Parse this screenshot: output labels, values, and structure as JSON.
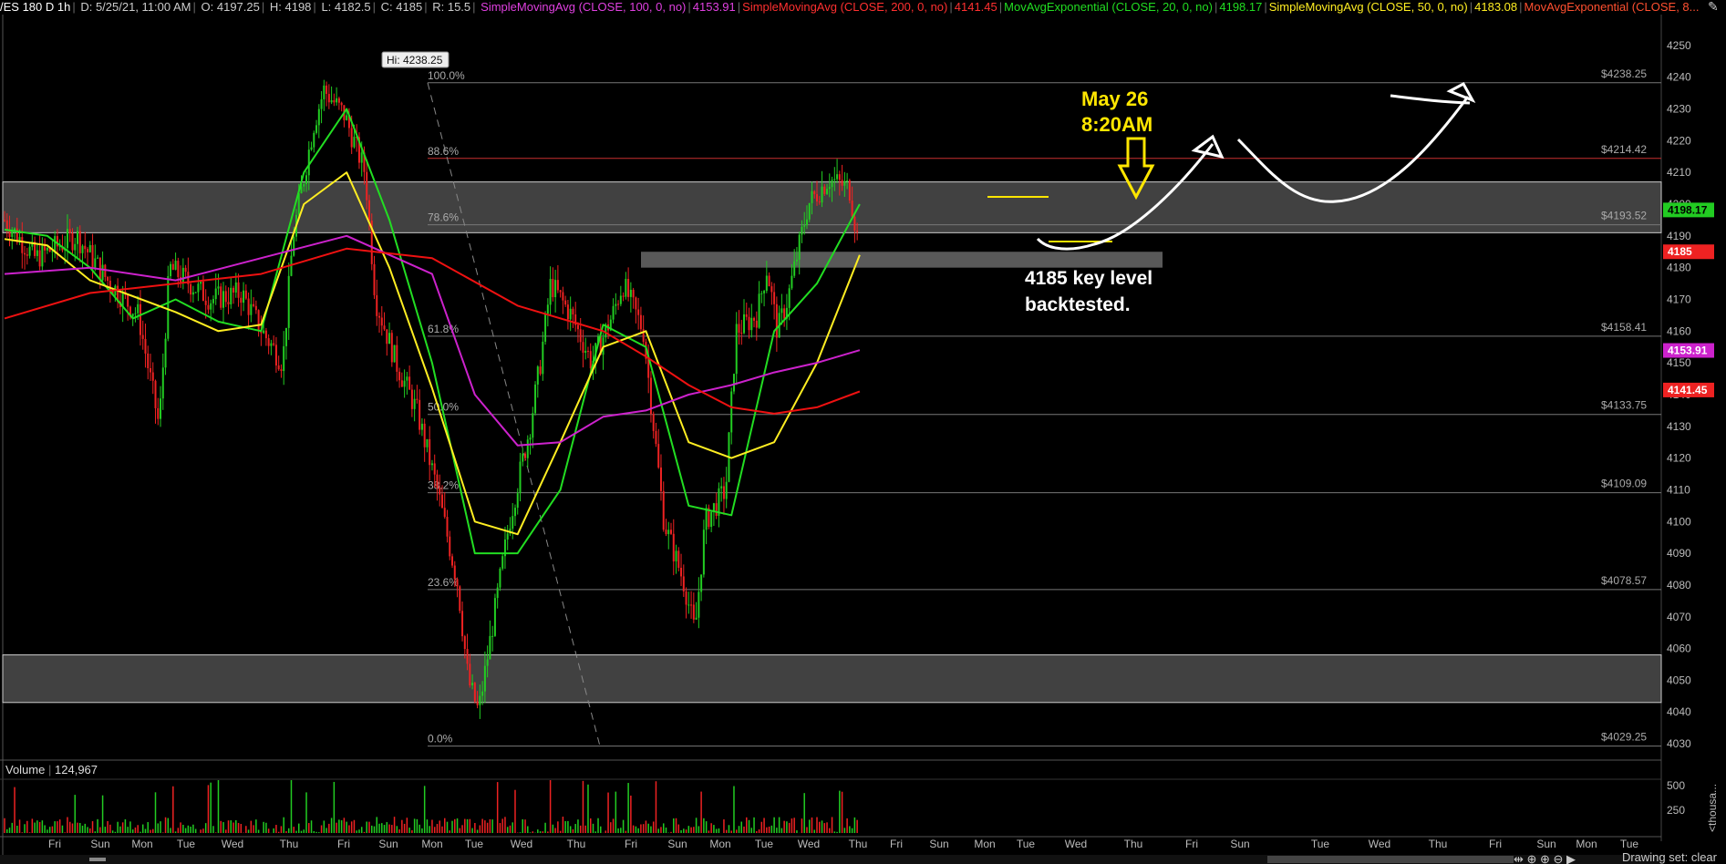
{
  "header": {
    "symbol": "/ES 180 D 1h",
    "date": "D: 5/25/21, 11:00 AM",
    "open": "O: 4197.25",
    "high": "H: 4198",
    "low": "L: 4182.5",
    "close": "C: 4185",
    "range": "R: 15.5",
    "studies": [
      {
        "label": "SimpleMovingAvg (CLOSE, 100, 0, no)",
        "value": "4153.91",
        "color": "#e040e0"
      },
      {
        "label": "SimpleMovingAvg (CLOSE, 200, 0, no)",
        "value": "4141.45",
        "color": "#ff3030"
      },
      {
        "label": "MovAvgExponential (CLOSE, 20, 0, no)",
        "value": "4198.17",
        "color": "#22dd22"
      },
      {
        "label": "SimpleMovingAvg (CLOSE, 50, 0, no)",
        "value": "4183.08",
        "color": "#ffee22"
      },
      {
        "label": "MovAvgExponential (CLOSE, 8...",
        "value": "",
        "color": "#ff5030"
      }
    ]
  },
  "colors": {
    "up": "#22cc22",
    "down": "#ee2222",
    "ema20": "#22dd22",
    "sma50": "#ffee22",
    "sma100": "#cc22cc",
    "sma200": "#ee1111",
    "zone": "#777777",
    "annotation_yellow": "#ffe600"
  },
  "chart_data": {
    "type": "candlestick",
    "ylim": [
      4026,
      4258
    ],
    "y_ticks": [
      4030,
      4040,
      4050,
      4060,
      4070,
      4080,
      4090,
      4100,
      4110,
      4120,
      4130,
      4140,
      4150,
      4160,
      4170,
      4180,
      4190,
      4200,
      4210,
      4220,
      4230,
      4240,
      4250
    ],
    "x_tick_labels": [
      "Fri",
      "Sun",
      "Mon",
      "Tue",
      "Wed",
      "Thu",
      "Fri",
      "Sun",
      "Mon",
      "Tue",
      "Wed",
      "Thu",
      "Fri",
      "Sun",
      "Mon",
      "Tue",
      "Wed",
      "Thu",
      "Fri",
      "Sun",
      "Mon",
      "Tue",
      "Wed",
      "Thu",
      "Fri",
      "Sun",
      "Tue",
      "Wed",
      "Thu",
      "Fri",
      "Sun",
      "Mon",
      "Tue"
    ],
    "high_label": "Hi: 4238.25",
    "fib_levels": [
      {
        "pct": "100.0%",
        "price": 4238.25,
        "label": "$4238.25"
      },
      {
        "pct": "88.6%",
        "price": 4214.42,
        "label": "$4214.42"
      },
      {
        "pct": "78.6%",
        "price": 4193.52,
        "label": "$4193.52"
      },
      {
        "pct": "61.8%",
        "price": 4158.41,
        "label": "$4158.41"
      },
      {
        "pct": "50.0%",
        "price": 4133.75,
        "label": "$4133.75"
      },
      {
        "pct": "38.2%",
        "price": 4109.09,
        "label": "$4109.09"
      },
      {
        "pct": "23.6%",
        "price": 4078.57,
        "label": "$4078.57"
      },
      {
        "pct": "0.0%",
        "price": 4029.25,
        "label": "$4029.25"
      }
    ],
    "zones": [
      {
        "y_low": 4191,
        "y_high": 4207,
        "span": "full"
      },
      {
        "y_low": 4180,
        "y_high": 4185,
        "span": "partial"
      },
      {
        "y_low": 4043,
        "y_high": 4058,
        "span": "full"
      }
    ],
    "price_tags": [
      {
        "value": "4198.17",
        "price": 4198.17,
        "bg": "#22cc22",
        "fg": "#000000"
      },
      {
        "value": "4185",
        "price": 4185,
        "bg": "#ee2222",
        "fg": "#ffffff"
      },
      {
        "value": "4153.91",
        "price": 4153.91,
        "bg": "#cc22cc",
        "fg": "#ffffff"
      },
      {
        "value": "4141.45",
        "price": 4141.45,
        "bg": "#ee2222",
        "fg": "#ffffff"
      }
    ],
    "series": [
      {
        "name": "MovAvgExponential (CLOSE, 20, 0, no)",
        "x": [
          0,
          0.05,
          0.1,
          0.15,
          0.2,
          0.25,
          0.3,
          0.35,
          0.4,
          0.45,
          0.5,
          0.55,
          0.6,
          0.65,
          0.7,
          0.75,
          0.8,
          0.85,
          0.9,
          0.95,
          1
        ],
        "y": [
          4192,
          4190,
          4180,
          4164,
          4170,
          4163,
          4160,
          4210,
          4230,
          4195,
          4150,
          4090,
          4090,
          4110,
          4162,
          4155,
          4105,
          4102,
          4160,
          4175,
          4200
        ]
      },
      {
        "name": "SimpleMovingAvg (CLOSE, 50, 0, no)",
        "x": [
          0,
          0.05,
          0.1,
          0.15,
          0.2,
          0.25,
          0.3,
          0.35,
          0.4,
          0.45,
          0.5,
          0.55,
          0.6,
          0.65,
          0.7,
          0.75,
          0.8,
          0.85,
          0.9,
          0.95,
          1
        ],
        "y": [
          4189,
          4187,
          4176,
          4171,
          4166,
          4160,
          4162,
          4200,
          4210,
          4180,
          4142,
          4100,
          4096,
          4125,
          4155,
          4160,
          4125,
          4120,
          4125,
          4150,
          4184
        ]
      },
      {
        "name": "SimpleMovingAvg (CLOSE, 100, 0, no)",
        "x": [
          0,
          0.1,
          0.2,
          0.3,
          0.4,
          0.5,
          0.55,
          0.6,
          0.65,
          0.7,
          0.75,
          0.8,
          0.85,
          0.9,
          0.95,
          1
        ],
        "y": [
          4178,
          4180,
          4176,
          4183,
          4190,
          4178,
          4140,
          4124,
          4125,
          4133,
          4135,
          4140,
          4143,
          4147,
          4150,
          4154
        ]
      },
      {
        "name": "SimpleMovingAvg (CLOSE, 200, 0, no)",
        "x": [
          0,
          0.1,
          0.2,
          0.3,
          0.4,
          0.5,
          0.6,
          0.7,
          0.75,
          0.8,
          0.85,
          0.9,
          0.95,
          1
        ],
        "y": [
          4164,
          4172,
          4175,
          4178,
          4186,
          4183,
          4168,
          4160,
          4152,
          4143,
          4136,
          4134,
          4136,
          4141
        ]
      }
    ],
    "volume": {
      "label": "Volume",
      "value": "124,967",
      "y_ticks": [
        250,
        500
      ],
      "y_axis_label": "<thousa..."
    }
  },
  "annotations": {
    "date_line1": "May 26",
    "date_line2": "8:20AM",
    "level_line1": "4185 key level",
    "level_line2": "backtested."
  },
  "footer": {
    "drawing_set": "Drawing set: clear"
  }
}
